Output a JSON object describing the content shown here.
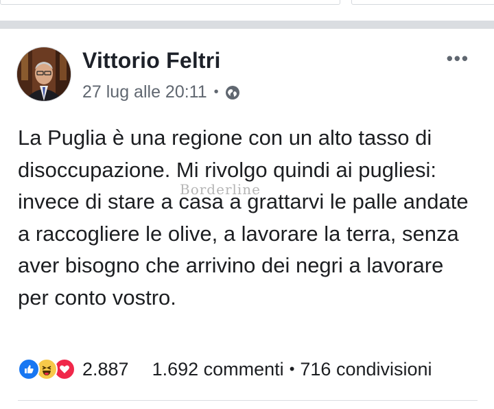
{
  "post": {
    "author": "Vittorio Feltri",
    "timestamp": "27 lug alle 20:11",
    "privacy_icon": "globe-icon",
    "more_icon": "more-horizontal-icon",
    "body": "La Puglia è una regione con un alto tasso di disoccupazione. Mi rivolgo quindi ai pugliesi: invece di stare a casa a grattarvi le palle andate a raccogliere le olive, a lavorare la terra, senza aver bisogno che arrivino dei negri a lavorare per conto vostro.",
    "watermark": "Borderline"
  },
  "stats": {
    "reactions": [
      "like",
      "haha",
      "love"
    ],
    "reaction_count": "2.887",
    "comments": "1.692 commenti",
    "separator": "•",
    "shares": "716 condivisioni"
  },
  "colors": {
    "like": "#1877f2",
    "haha": "#f7c94a",
    "love": "#f0284a",
    "meta_text": "#606770"
  }
}
